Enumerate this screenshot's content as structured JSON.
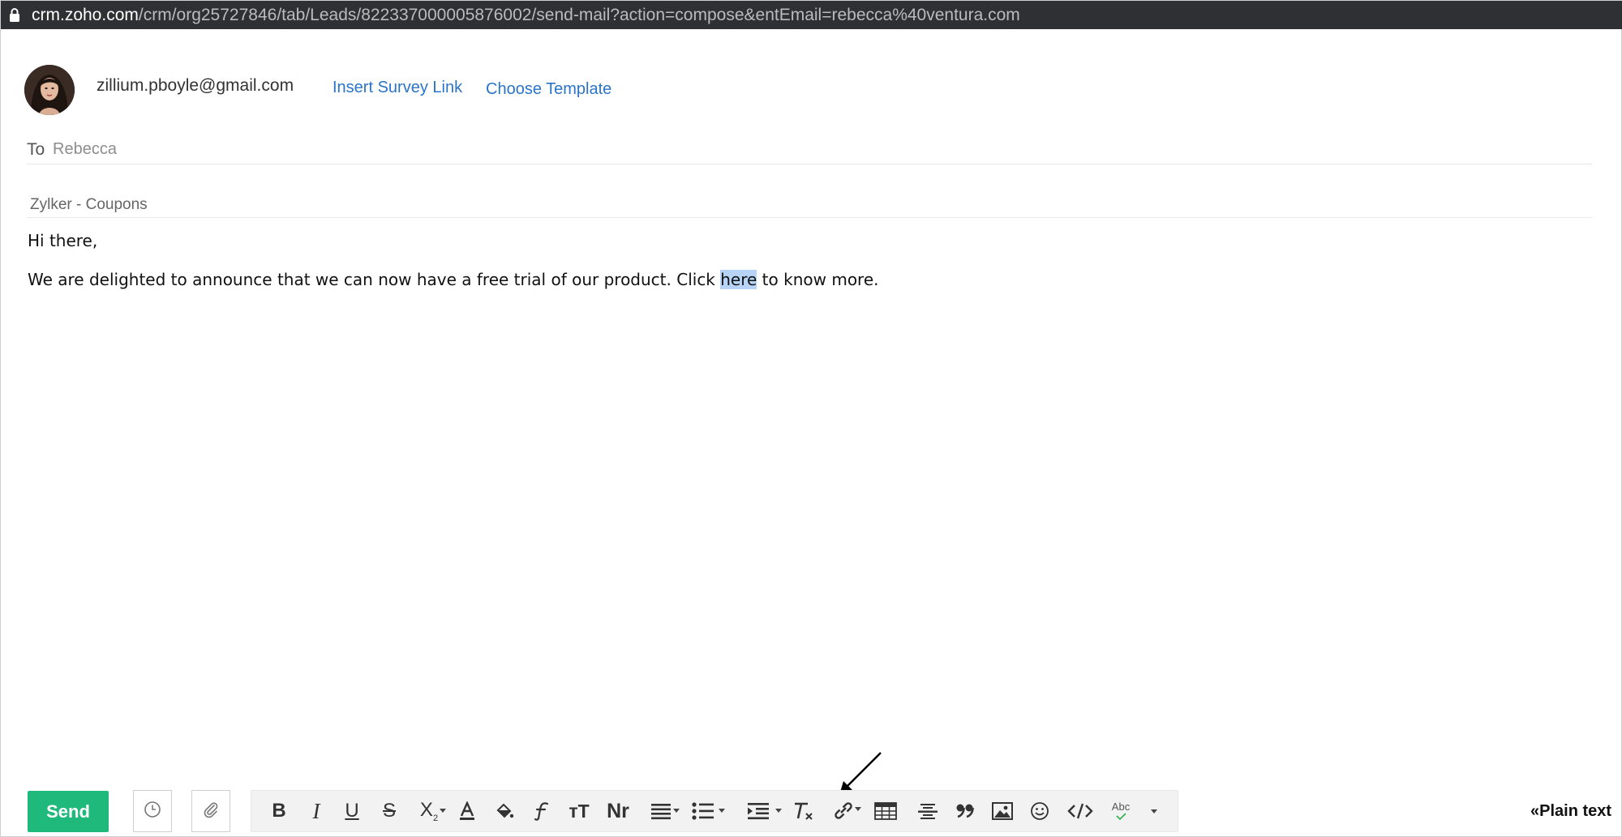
{
  "browser": {
    "url_host": "crm.zoho.com",
    "url_path": "/crm/org25727846/tab/Leads/822337000005876002/send-mail?action=compose&entEmail=rebecca%40ventura.com"
  },
  "compose": {
    "from_email": "zillium.pboyle@gmail.com",
    "insert_survey_link": "Insert Survey Link",
    "choose_template": "Choose Template",
    "to_label": "To",
    "to_value": "Rebecca",
    "subject": "Zylker - Coupons",
    "body": {
      "greeting": "Hi there,",
      "para_before": "We are delighted to announce that we can now have a free trial of our product. Click ",
      "para_highlight": "here",
      "para_after": " to know more."
    }
  },
  "footer": {
    "send_label": "Send",
    "plain_text_label": "«Plain text"
  },
  "toolbar_glyphs": {
    "bold": "B",
    "italic": "I",
    "underline": "U",
    "strike": "S",
    "subscript": "X",
    "subscript_small": "2",
    "font_size": "тT",
    "normal": "Nr",
    "spellcheck": "Abc"
  },
  "icons": [
    "lock-icon",
    "clock-icon",
    "paperclip-icon",
    "bold-icon",
    "italic-icon",
    "underline-icon",
    "strikethrough-icon",
    "subscript-icon",
    "font-color-icon",
    "highlight-icon",
    "font-family-icon",
    "font-size-icon",
    "format-icon",
    "align-icon",
    "list-icon",
    "indent-icon",
    "clear-format-icon",
    "link-icon",
    "table-icon",
    "horizontal-rule-icon",
    "quote-icon",
    "image-icon",
    "emoji-icon",
    "code-icon",
    "spellcheck-icon",
    "more-icon",
    "arrow-annotation-icon"
  ],
  "colors": {
    "accent_link": "#2a74c9",
    "send_green": "#1fba7b",
    "highlight": "#b7d4f6",
    "urlbar": "#2f3033"
  }
}
